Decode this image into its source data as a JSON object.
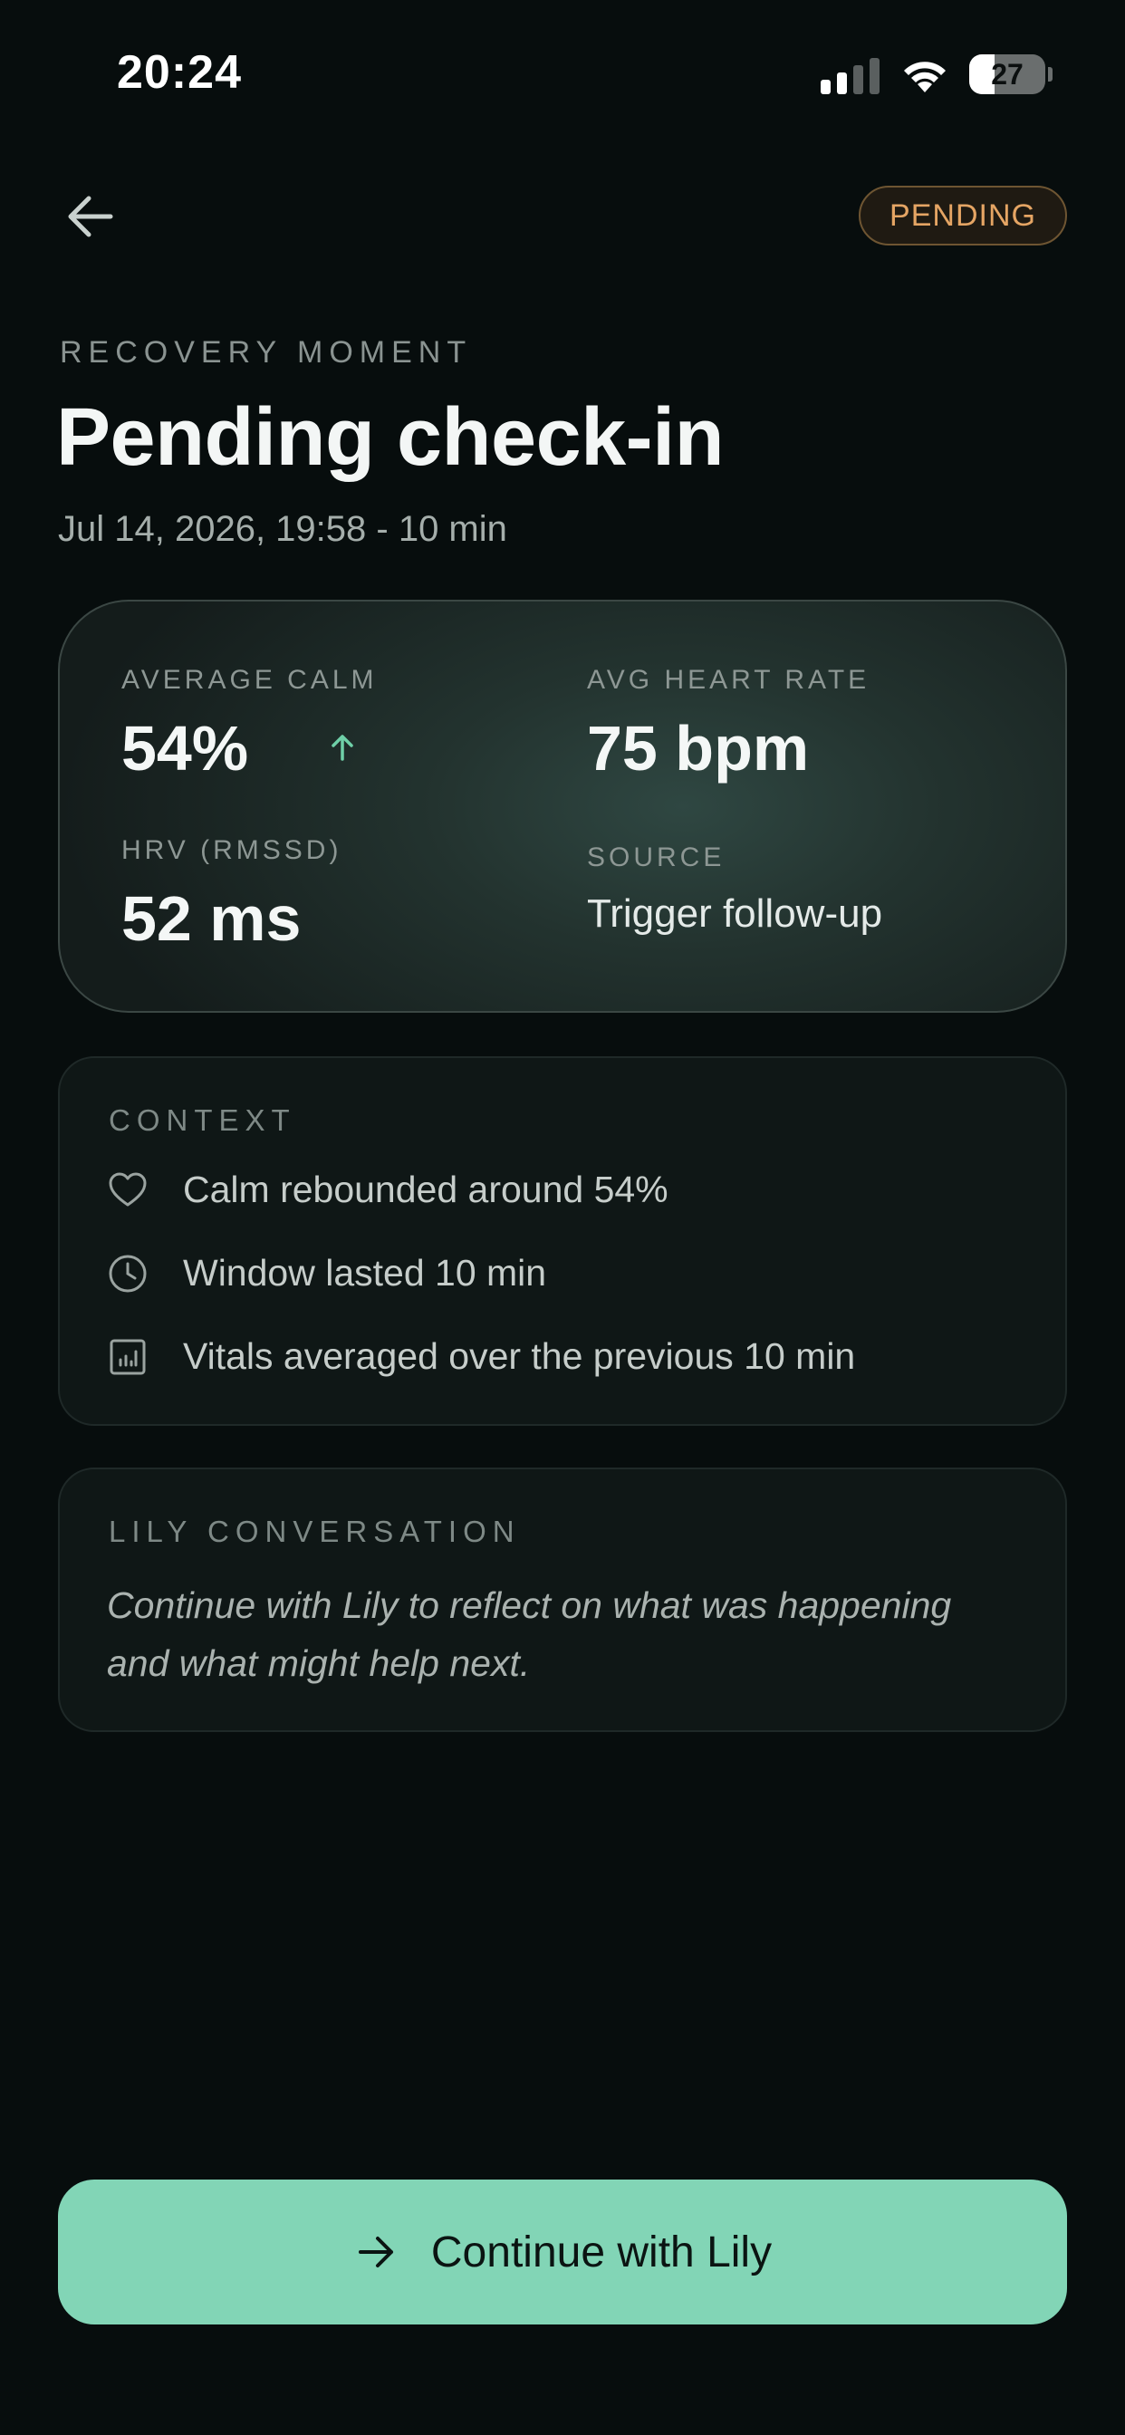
{
  "status_bar": {
    "time": "20:24",
    "battery": "27"
  },
  "header": {
    "back_icon": "arrow-left-icon",
    "badge": "PENDING",
    "badge_color": "#e5a564"
  },
  "page": {
    "eyebrow": "RECOVERY MOMENT",
    "title": "Pending check-in",
    "subtitle": "Jul 14, 2026, 19:58 - 10 min"
  },
  "stats": {
    "avg_calm_label": "AVERAGE CALM",
    "avg_calm_value": "54%",
    "avg_calm_trend_icon": "arrow-up-icon",
    "avg_hr_label": "AVG HEART RATE",
    "avg_hr_value": "75 bpm",
    "hrv_label": "HRV (RMSSD)",
    "hrv_value": "52 ms",
    "source_label": "SOURCE",
    "source_value": "Trigger follow-up"
  },
  "context": {
    "title": "CONTEXT",
    "items": [
      {
        "icon": "heart-icon",
        "text": "Calm rebounded around 54%"
      },
      {
        "icon": "clock-icon",
        "text": "Window lasted 10 min"
      },
      {
        "icon": "chart-icon",
        "text": "Vitals averaged over the previous 10 min"
      }
    ]
  },
  "lily": {
    "title": "LILY CONVERSATION",
    "body": "Continue with Lily to reflect on what was happening and what might help next."
  },
  "cta": {
    "icon": "arrow-right-icon",
    "label": "Continue with Lily",
    "color": "#82d5b6"
  },
  "colors": {
    "background": "#070d0d",
    "accent": "#82d5b6"
  }
}
